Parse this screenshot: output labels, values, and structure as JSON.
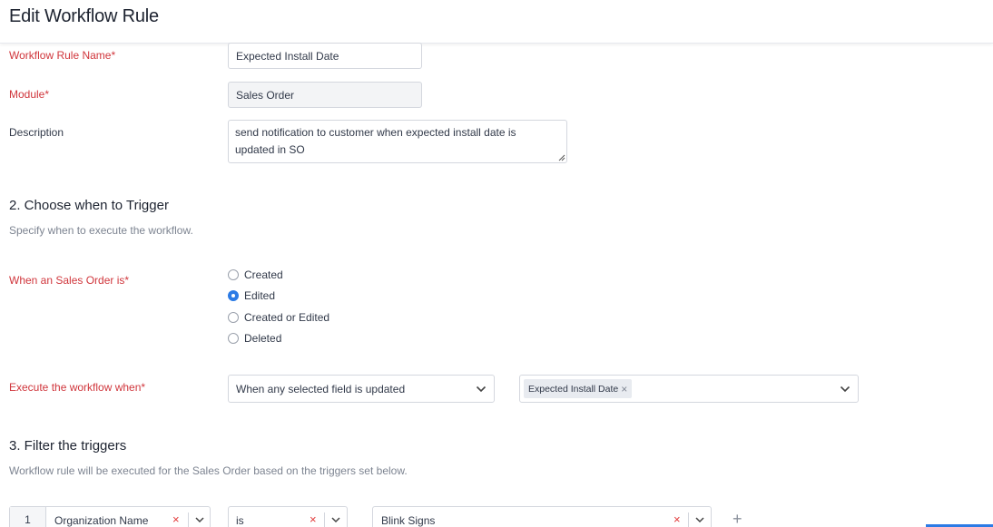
{
  "header": {
    "title": "Edit Workflow Rule"
  },
  "basic": {
    "rule_name_label": "Workflow Rule Name*",
    "rule_name_value": "Expected Install Date",
    "module_label": "Module*",
    "module_value": "Sales Order",
    "description_label": "Description",
    "description_line1": "send notification to customer when expected install date is",
    "description_line2": "updated in SO"
  },
  "trigger": {
    "title": "2. Choose when to Trigger",
    "subtitle": "Specify when to execute the workflow.",
    "when_label": "When an Sales Order is*",
    "options": [
      {
        "label": "Created",
        "checked": false
      },
      {
        "label": "Edited",
        "checked": true
      },
      {
        "label": "Created or Edited",
        "checked": false
      },
      {
        "label": "Deleted",
        "checked": false
      }
    ],
    "execute_label": "Execute the workflow when*",
    "execute_value": "When any selected field is updated",
    "selected_field_chip": "Expected Install Date"
  },
  "filters": {
    "title": "3. Filter the triggers",
    "subtitle": "Workflow rule will be executed for the Sales Order based on the triggers set below.",
    "rows": [
      {
        "index": "1",
        "field": "Organization Name",
        "operator": "is",
        "value": "Blink Signs"
      }
    ],
    "add_symbol": "+"
  },
  "colors": {
    "required_label": "#d0363c",
    "accent": "#2c7be5",
    "clear_x": "#e23b3b"
  },
  "icons": {
    "dropdown": "chevron-down-icon",
    "clear": "close-icon",
    "add": "plus-icon"
  }
}
